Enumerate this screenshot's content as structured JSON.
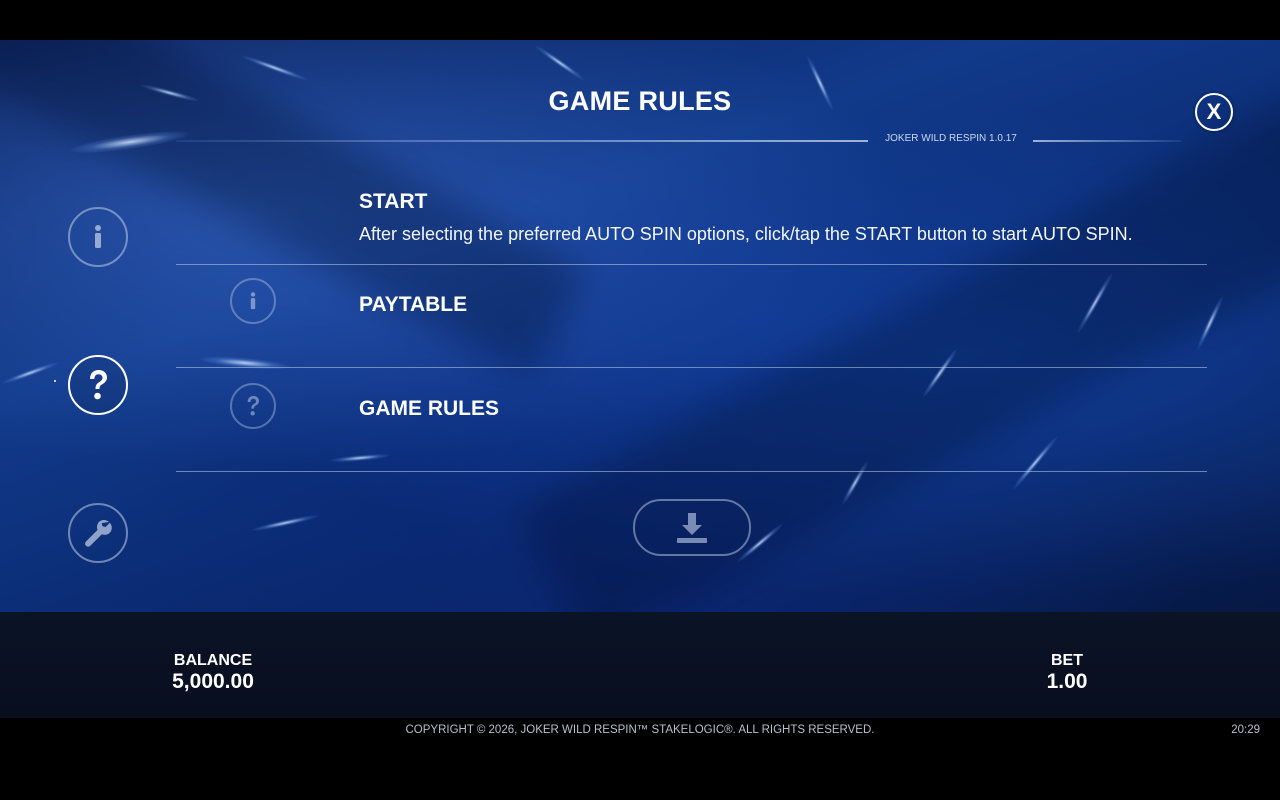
{
  "header": {
    "title": "GAME RULES",
    "version": "JOKER WILD RESPIN 1.0.17",
    "close_label": "X"
  },
  "sidebar": {
    "items": [
      {
        "icon": "info-icon",
        "state": "inactive"
      },
      {
        "icon": "question-icon",
        "state": "active"
      },
      {
        "icon": "wrench-icon",
        "state": "inactive"
      }
    ]
  },
  "sections": [
    {
      "title": "START",
      "description": "After selecting the preferred AUTO SPIN options, click/tap the START button to start AUTO SPIN."
    },
    {
      "title": "PAYTABLE",
      "icon": "info-icon"
    },
    {
      "title": "GAME RULES",
      "icon": "question-icon"
    }
  ],
  "download": {
    "icon": "download-icon"
  },
  "status": {
    "balance_label": "BALANCE",
    "balance_value": "5,000.00",
    "bet_label": "BET",
    "bet_value": "1.00"
  },
  "footer": {
    "copyright": "COPYRIGHT © 2026, JOKER WILD RESPIN™ STAKELOGIC®. ALL RIGHTS RESERVED.",
    "time": "20:29"
  },
  "colors": {
    "background": "#0d2f7a",
    "accent": "#ffffff",
    "bottom_bar": "#0a1225"
  }
}
